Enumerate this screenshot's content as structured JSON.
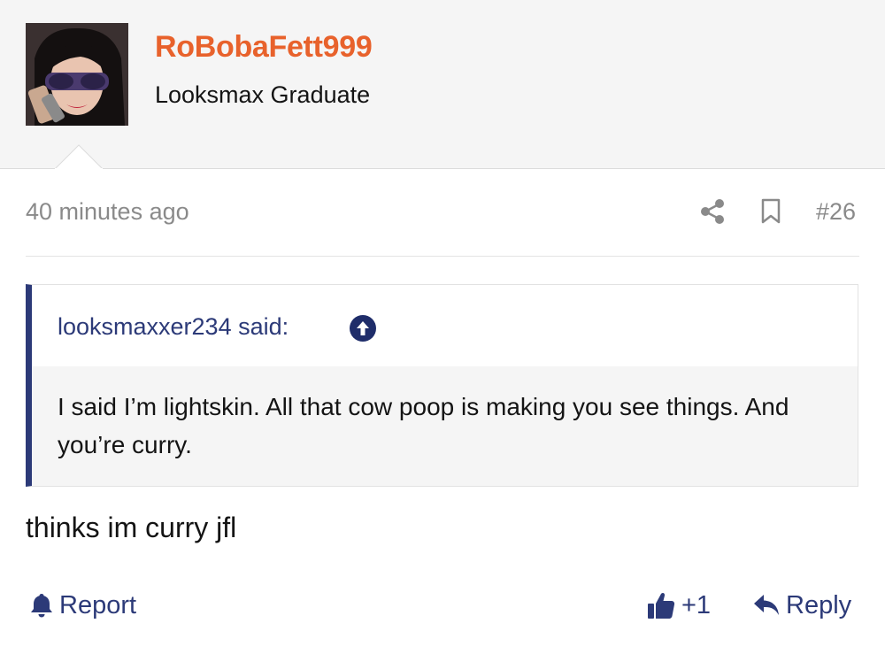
{
  "post": {
    "author": {
      "username": "RoBobaFett999",
      "title": "Looksmax Graduate"
    },
    "timestamp": "40 minutes ago",
    "number": "#26",
    "quote": {
      "author_label": "looksmaxxer234 said:",
      "text": "I said I’m lightskin. All that cow poop is making you see things. And you’re curry."
    },
    "body": "thinks im curry jfl"
  },
  "footer": {
    "report_label": "Report",
    "like_count": "+1",
    "reply_label": "Reply"
  },
  "icons": {
    "share": "share-icon",
    "bookmark": "bookmark-icon",
    "quote_jump": "arrow-up-circle-icon",
    "report": "bell-icon",
    "like": "thumbs-up-icon",
    "reply": "reply-arrow-icon"
  },
  "colors": {
    "username": "#e8622c",
    "accent": "#2c3a78",
    "muted": "#8a8a8a",
    "header_bg": "#f5f5f5",
    "quote_bg": "#f5f5f5"
  }
}
